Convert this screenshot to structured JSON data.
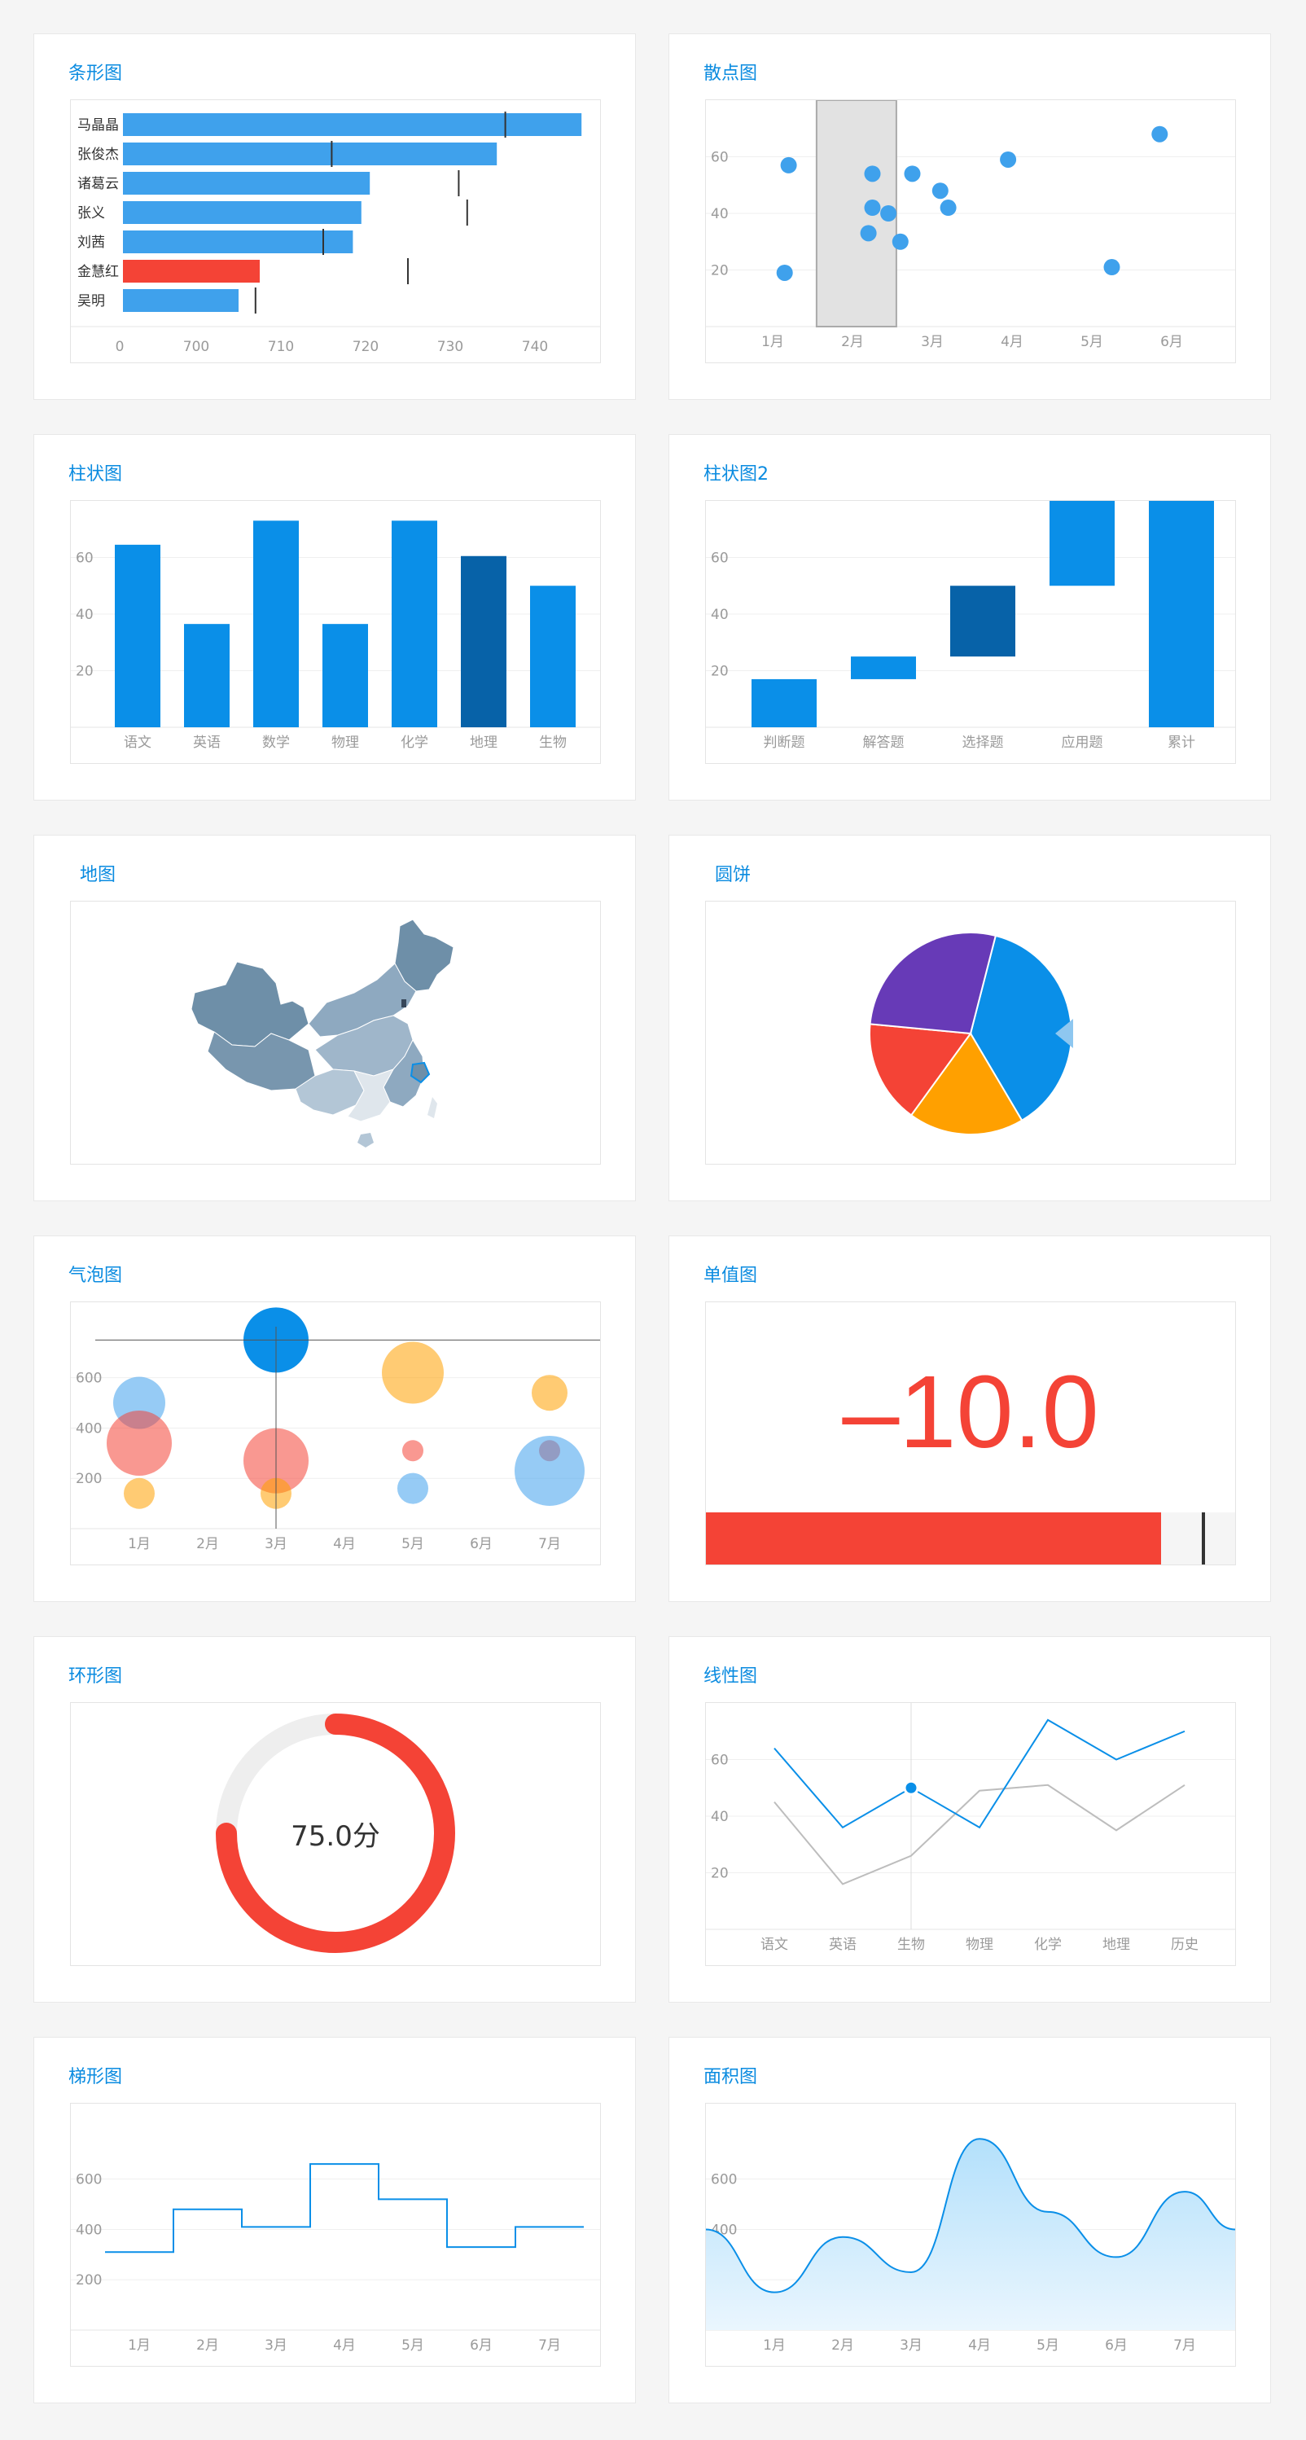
{
  "colors": {
    "blue": "#0a8fe8",
    "light_blue": "#3fa1ec",
    "dark_blue": "#0762a8",
    "red": "#f44336",
    "orange": "#ffa000",
    "purple": "#673ab7",
    "grey_line": "#bdbdbd",
    "map_dark": "#6e8fa8",
    "map_mid": "#8ea9c0",
    "map_light": "#c8d6e2"
  },
  "cards": {
    "bar_h": {
      "title": "条形图"
    },
    "scatter": {
      "title": "散点图"
    },
    "column": {
      "title": "柱状图"
    },
    "waterfall": {
      "title": "柱状图2"
    },
    "map": {
      "title": "地图"
    },
    "pie": {
      "title": "圆饼"
    },
    "bubble": {
      "title": "气泡图"
    },
    "single": {
      "title": "单值图",
      "value": "–10.0"
    },
    "ring": {
      "title": "环形图",
      "value": "75.0分"
    },
    "line": {
      "title": "线性图"
    },
    "step": {
      "title": "梯形图"
    },
    "area": {
      "title": "面积图"
    }
  },
  "chart_data": [
    {
      "id": "bar_h",
      "type": "bar",
      "orientation": "horizontal",
      "categories": [
        "马晶晶",
        "张俊杰",
        "诸葛云",
        "张义",
        "刘茜",
        "金慧红",
        "吴明"
      ],
      "values": [
        745.5,
        735.5,
        720.5,
        719.5,
        718.5,
        707.5,
        705
      ],
      "targets": [
        736.5,
        716,
        731,
        732,
        715,
        725,
        707
      ],
      "highlight_index": 5,
      "ticks": [
        0,
        700,
        710,
        720,
        730,
        740
      ],
      "xlim": [
        690,
        748
      ]
    },
    {
      "id": "scatter",
      "type": "scatter",
      "categories": [
        "1月",
        "2月",
        "3月",
        "4月",
        "5月",
        "6月"
      ],
      "y_ticks": [
        20,
        40,
        60
      ],
      "ylim": [
        0,
        80
      ],
      "points": [
        [
          1.2,
          57
        ],
        [
          1.15,
          19
        ],
        [
          2.25,
          54
        ],
        [
          2.25,
          42
        ],
        [
          2.2,
          33
        ],
        [
          2.45,
          40
        ],
        [
          2.6,
          30
        ],
        [
          2.75,
          54
        ],
        [
          3.1,
          48
        ],
        [
          3.2,
          42
        ],
        [
          3.95,
          59
        ],
        [
          5.25,
          21
        ],
        [
          5.85,
          68
        ]
      ],
      "selection": {
        "from": "2月",
        "to": "3月"
      }
    },
    {
      "id": "column",
      "type": "bar",
      "categories": [
        "语文",
        "英语",
        "数学",
        "物理",
        "化学",
        "地理",
        "生物"
      ],
      "values": [
        64.5,
        36.5,
        73,
        36.5,
        73,
        60.5,
        50
      ],
      "highlight_index": 5,
      "y_ticks": [
        20,
        40,
        60
      ],
      "ylim": [
        0,
        80
      ]
    },
    {
      "id": "waterfall",
      "type": "bar",
      "subtype": "waterfall",
      "categories": [
        "判断题",
        "解答题",
        "选择题",
        "应用题",
        "累计"
      ],
      "ranges": [
        [
          0,
          17
        ],
        [
          17,
          25
        ],
        [
          25,
          50
        ],
        [
          50,
          80
        ],
        [
          0,
          80
        ]
      ],
      "highlight_index": 2,
      "y_ticks": [
        20,
        40,
        60
      ],
      "ylim": [
        0,
        80
      ]
    },
    {
      "id": "pie",
      "type": "pie",
      "slices": [
        {
          "value": 37.5,
          "color": "#0a8fe8"
        },
        {
          "value": 18.5,
          "color": "#ffa000"
        },
        {
          "value": 16.5,
          "color": "#f44336"
        },
        {
          "value": 27.5,
          "color": "#673ab7"
        }
      ]
    },
    {
      "id": "bubble",
      "type": "scatter",
      "subtype": "bubble",
      "categories": [
        "1月",
        "2月",
        "3月",
        "4月",
        "5月",
        "6月",
        "7月"
      ],
      "y_ticks": [
        200,
        400,
        600
      ],
      "ylim": [
        0,
        900
      ],
      "bubbles": [
        {
          "x": "1月",
          "y": 500,
          "r": 32,
          "color": "#3fa1ec"
        },
        {
          "x": "1月",
          "y": 340,
          "r": 40,
          "color": "#f44336"
        },
        {
          "x": "1月",
          "y": 140,
          "r": 19,
          "color": "#ffa000"
        },
        {
          "x": "3月",
          "y": 750,
          "r": 40,
          "color": "#0a8fe8"
        },
        {
          "x": "3月",
          "y": 270,
          "r": 40,
          "color": "#f44336"
        },
        {
          "x": "3月",
          "y": 140,
          "r": 19,
          "color": "#ffa000"
        },
        {
          "x": "5月",
          "y": 620,
          "r": 38,
          "color": "#ffa000"
        },
        {
          "x": "5月",
          "y": 310,
          "r": 13,
          "color": "#f44336"
        },
        {
          "x": "5月",
          "y": 160,
          "r": 19,
          "color": "#3fa1ec"
        },
        {
          "x": "7月",
          "y": 540,
          "r": 22,
          "color": "#ffa000"
        },
        {
          "x": "7月",
          "y": 310,
          "r": 13,
          "color": "#f44336"
        },
        {
          "x": "7月",
          "y": 230,
          "r": 43,
          "color": "#3fa1ec"
        }
      ],
      "crosshair": {
        "x": "3月",
        "y": 750
      }
    },
    {
      "id": "single",
      "type": "bar",
      "subtype": "bullet",
      "value": -10.0,
      "fill": 0.86,
      "marker": 0.94
    },
    {
      "id": "ring",
      "type": "pie",
      "subtype": "ring",
      "value": 75.0,
      "percent": 0.75
    },
    {
      "id": "line",
      "type": "line",
      "categories": [
        "语文",
        "英语",
        "生物",
        "物理",
        "化学",
        "地理",
        "历史"
      ],
      "series": [
        {
          "values": [
            64,
            36,
            50,
            36,
            74,
            60,
            70
          ],
          "color": "#0a8fe8"
        },
        {
          "values": [
            45,
            16,
            26,
            49,
            51,
            35,
            51
          ],
          "color": "#bdbdbd"
        }
      ],
      "y_ticks": [
        20,
        40,
        60
      ],
      "ylim": [
        0,
        80
      ],
      "hover_index": 2
    },
    {
      "id": "step",
      "type": "line",
      "subtype": "step",
      "categories": [
        "1月",
        "2月",
        "3月",
        "4月",
        "5月",
        "6月",
        "7月"
      ],
      "values": [
        310,
        480,
        410,
        660,
        520,
        330,
        410
      ],
      "y_ticks": [
        200,
        400,
        600
      ],
      "ylim": [
        0,
        900
      ]
    },
    {
      "id": "area",
      "type": "area",
      "categories": [
        "1月",
        "2月",
        "3月",
        "4月",
        "5月",
        "6月",
        "7月"
      ],
      "values": [
        150,
        370,
        230,
        760,
        470,
        290,
        550
      ],
      "start_value": 400,
      "end_value": 400,
      "y_ticks": [
        200,
        400,
        600
      ],
      "ylim": [
        0,
        900
      ]
    }
  ]
}
